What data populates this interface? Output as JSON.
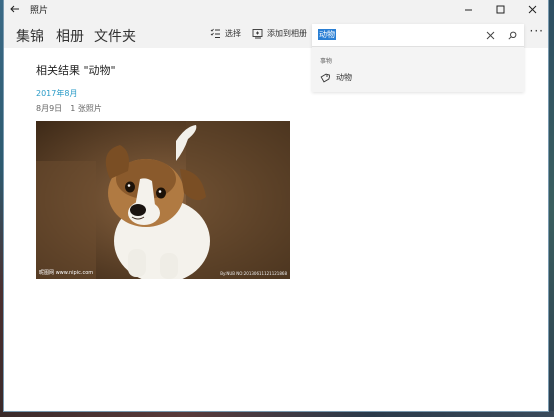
{
  "window": {
    "title": "照片"
  },
  "nav": {
    "tabs": [
      {
        "label": "集锦"
      },
      {
        "label": "相册"
      },
      {
        "label": "文件夹"
      }
    ]
  },
  "toolbar": {
    "select_label": "选择",
    "add_to_album_label": "添加到相册",
    "more_label": "···"
  },
  "search": {
    "value": "动物",
    "suggestion_header": "事物",
    "suggestions": [
      {
        "label": "动物",
        "icon": "tag-icon"
      }
    ]
  },
  "results": {
    "title": "相关结果 \"动物\"",
    "groups": [
      {
        "month": "2017年8月",
        "date": "8月9日",
        "count": "1 张照片"
      }
    ]
  },
  "photo": {
    "subject": "puppy",
    "watermark_left": "昵图网 www.nipic.com",
    "watermark_right": "By:NUB NO:20130611121121868"
  },
  "colors": {
    "accent": "#2a9bc7",
    "highlight": "#2a7fd4",
    "chrome": "#f2f2f2"
  }
}
